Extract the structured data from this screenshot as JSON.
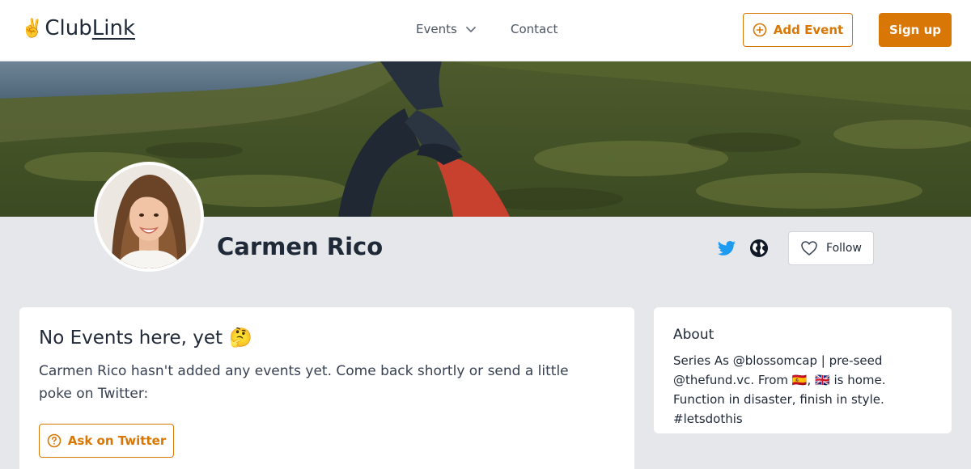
{
  "header": {
    "logo_emoji": "✌️",
    "logo_part1": "Club",
    "logo_part2": "Link",
    "nav_events": "Events",
    "nav_contact": "Contact",
    "add_event_label": "Add Event",
    "signup_label": "Sign up"
  },
  "profile": {
    "name": "Carmen Rico",
    "follow_label": "Follow"
  },
  "events_card": {
    "title": "No Events here, yet",
    "title_emoji": "🤔",
    "message": "Carmen Rico hasn't added any events yet. Come back shortly or send a little poke on Twitter:",
    "ask_label": "Ask on Twitter"
  },
  "about_card": {
    "title": "About",
    "bio": "Series As @blossomcap | pre-seed @thefund.vc. From 🇪🇸, 🇬🇧 is home. Function in disaster, finish in style. #letsdothis"
  },
  "colors": {
    "accent": "#d97706",
    "twitter": "#1d9bf0",
    "page_background": "#e5e7eb"
  }
}
